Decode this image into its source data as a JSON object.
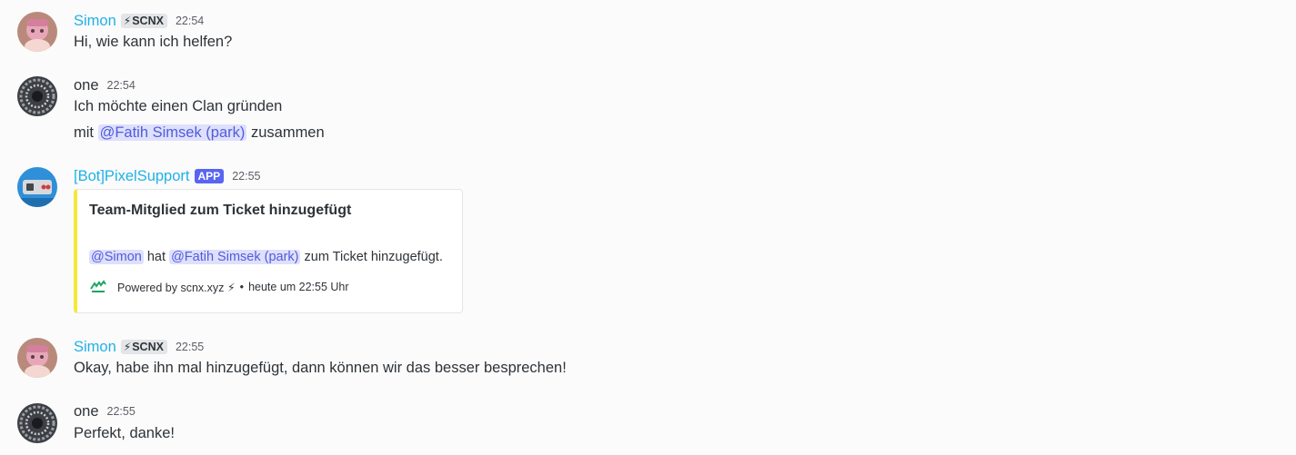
{
  "messages": [
    {
      "author": "Simon",
      "author_color": "#1fb1e8",
      "tag_icon": "lightning-icon",
      "tag_label": "SCNX",
      "time": "22:54",
      "lines": [
        "Hi, wie kann ich helfen?"
      ]
    },
    {
      "author": "one",
      "time": "22:54",
      "line1": "Ich möchte einen Clan gründen",
      "line2_prefix": "mit",
      "line2_mention": "@Fatih Simsek (park)",
      "line2_suffix": "zusammen"
    },
    {
      "author": "[Bot]PixelSupport",
      "author_color": "#1fb1e8",
      "app_tag": "APP",
      "time": "22:55",
      "embed": {
        "accent_color": "#f5e83a",
        "title": "Team-Mitglied zum Ticket hinzugefügt",
        "mention1": "@Simon",
        "word_hat": "hat",
        "mention2": "@Fatih Simsek (park)",
        "desc_suffix": "zum Ticket hinzugefügt.",
        "footer_text": "Powered by scnx.xyz ⚡",
        "footer_sep": "•",
        "footer_time": "heute um 22:55 Uhr"
      }
    },
    {
      "author": "Simon",
      "tag_label": "SCNX",
      "time": "22:55",
      "line": "Okay, habe ihn mal hinzugefügt, dann können wir das besser besprechen!"
    },
    {
      "author": "one",
      "time": "22:55",
      "line": "Perfekt, danke!"
    }
  ]
}
